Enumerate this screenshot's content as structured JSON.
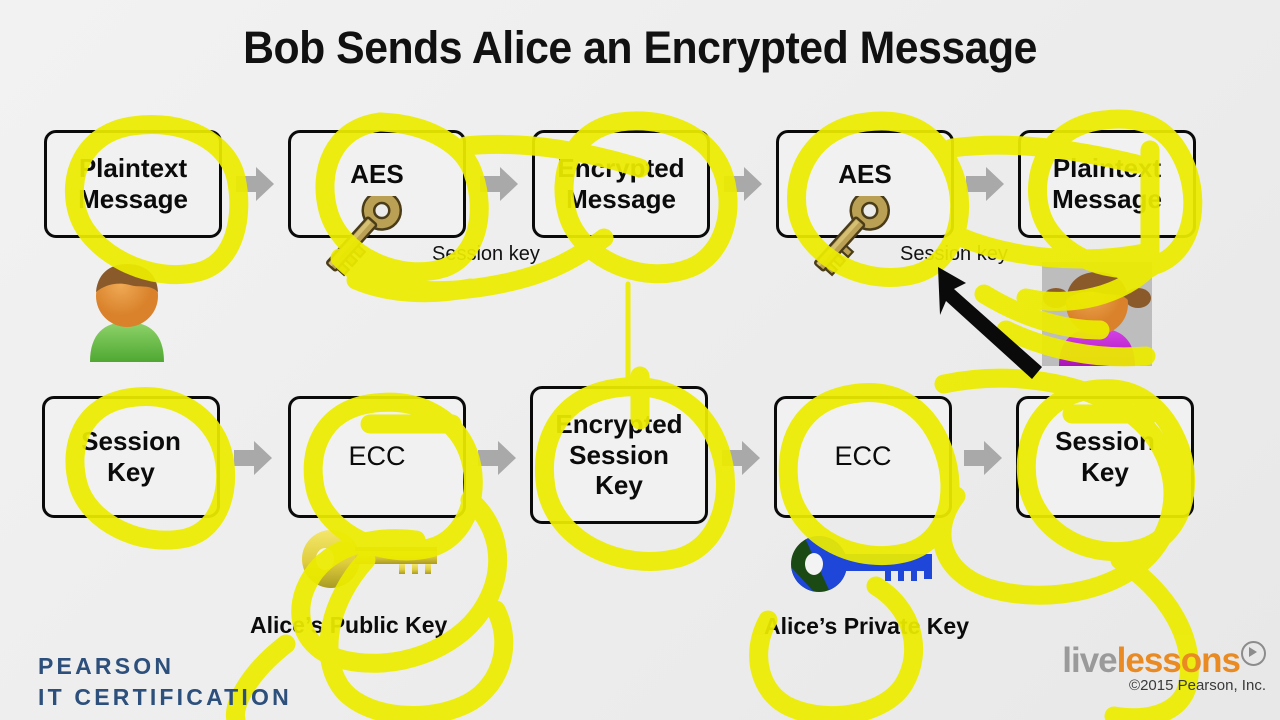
{
  "title": "Bob Sends Alice an Encrypted Message",
  "background_color": "#ececec",
  "highlight_color": "#ecec00",
  "top_row": {
    "boxes": [
      {
        "id": "plaintext-message-source",
        "label": "Plaintext\nMessage"
      },
      {
        "id": "aes-encrypt",
        "label": "AES"
      },
      {
        "id": "encrypted-message",
        "label": "Encrypted\nMessage"
      },
      {
        "id": "aes-decrypt",
        "label": "AES"
      },
      {
        "id": "plaintext-message-result",
        "label": "Plaintext\nMessage"
      }
    ],
    "session_key_label_left": "Session key",
    "session_key_label_right": "Session key"
  },
  "bottom_row": {
    "boxes": [
      {
        "id": "session-key-source",
        "label": "Session\nKey"
      },
      {
        "id": "ecc-encrypt",
        "label": "ECC"
      },
      {
        "id": "encrypted-session-key",
        "label": "Encrypted\nSession\nKey"
      },
      {
        "id": "ecc-decrypt",
        "label": "ECC"
      },
      {
        "id": "session-key-result",
        "label": "Session\nKey"
      }
    ],
    "public_key_caption": "Alice’s Public Key",
    "private_key_caption": "Alice’s Private Key"
  },
  "actors": {
    "bob": {
      "name": "Bob",
      "shirt_color": "#6cc24a",
      "hair_color": "#8a5a2b",
      "face_color": "#e8963c"
    },
    "alice": {
      "name": "Alice",
      "shirt_color": "#c026d3",
      "hair_color": "#8a5a2b",
      "face_color": "#e8963c"
    }
  },
  "keys": {
    "session_key_color": "#b09a4a",
    "public_key_color": "#e3d24a",
    "private_key_color": "#1e46d8"
  },
  "logos": {
    "pearson_line1": "PEARSON",
    "pearson_line2": "IT CERTIFICATION",
    "pearson_color": "#2d4f7c",
    "livelessons_part1": "live",
    "livelessons_part2": "lessons",
    "livelessons_color1": "#9a9a9a",
    "livelessons_color2": "#e98a22",
    "copyright": "©2015 Pearson, Inc."
  }
}
